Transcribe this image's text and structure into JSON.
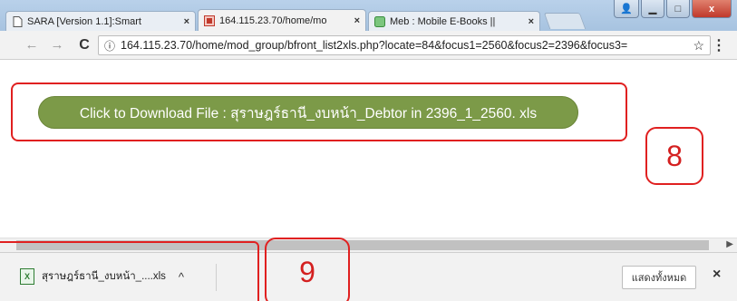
{
  "browser": {
    "tabs": [
      {
        "title": "SARA [Version 1.1]:Smart",
        "close": "×",
        "favicon": "page-icon"
      },
      {
        "title": "164.115.23.70/home/mo",
        "close": "×",
        "favicon": "site-icon"
      },
      {
        "title": "Meb : Mobile E-Books ||",
        "close": "×",
        "favicon": "meb-icon"
      }
    ],
    "window_controls": {
      "minimize": "▁",
      "maximize": "□",
      "close": "x",
      "user": "👤"
    },
    "nav": {
      "back": "←",
      "forward": "→",
      "reload": "C"
    },
    "address": {
      "info_icon": "ⓘ",
      "url": "164.115.23.70/home/mod_group/bfront_list2xls.php?locate=84&focus1=2560&focus2=2396&focus3=",
      "star": "☆"
    },
    "menu": "⋮"
  },
  "page": {
    "download_button_label": "Click to Download File : สุราษฎร์ธานี_งบหน้า_Debtor in 2396_1_2560. xls",
    "annotation_8": "8",
    "annotation_9": "9"
  },
  "download_shelf": {
    "file_name": "สุราษฎร์ธานี_งบหน้า_....xls",
    "caret": "^",
    "show_all_label": "แสดงทั้งหมด",
    "close": "×"
  },
  "colors": {
    "download_button": "#7c9a48",
    "annotation": "#e02020"
  }
}
